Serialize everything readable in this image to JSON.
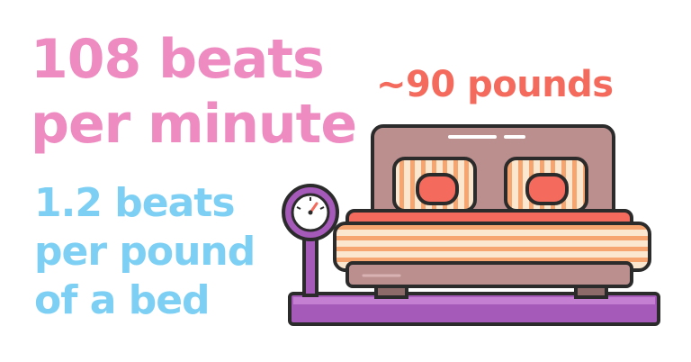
{
  "headline": {
    "line1": "108 beats",
    "line2": "per minute"
  },
  "sub": {
    "line1": "1.2 beats",
    "line2": "per pound",
    "line3": "of a bed"
  },
  "weight_label": "~90 pounds",
  "illustration": {
    "subject": "bed-on-scale",
    "colors": {
      "headline": "#ee8cc2",
      "sub": "#7dd0f4",
      "weight": "#f46a5c",
      "scale": "#a559b8",
      "headboard": "#bc8f8f",
      "mattress_stripe": "#f6a571",
      "pillow": "#f46a5c",
      "outline": "#2b2b2b"
    }
  }
}
